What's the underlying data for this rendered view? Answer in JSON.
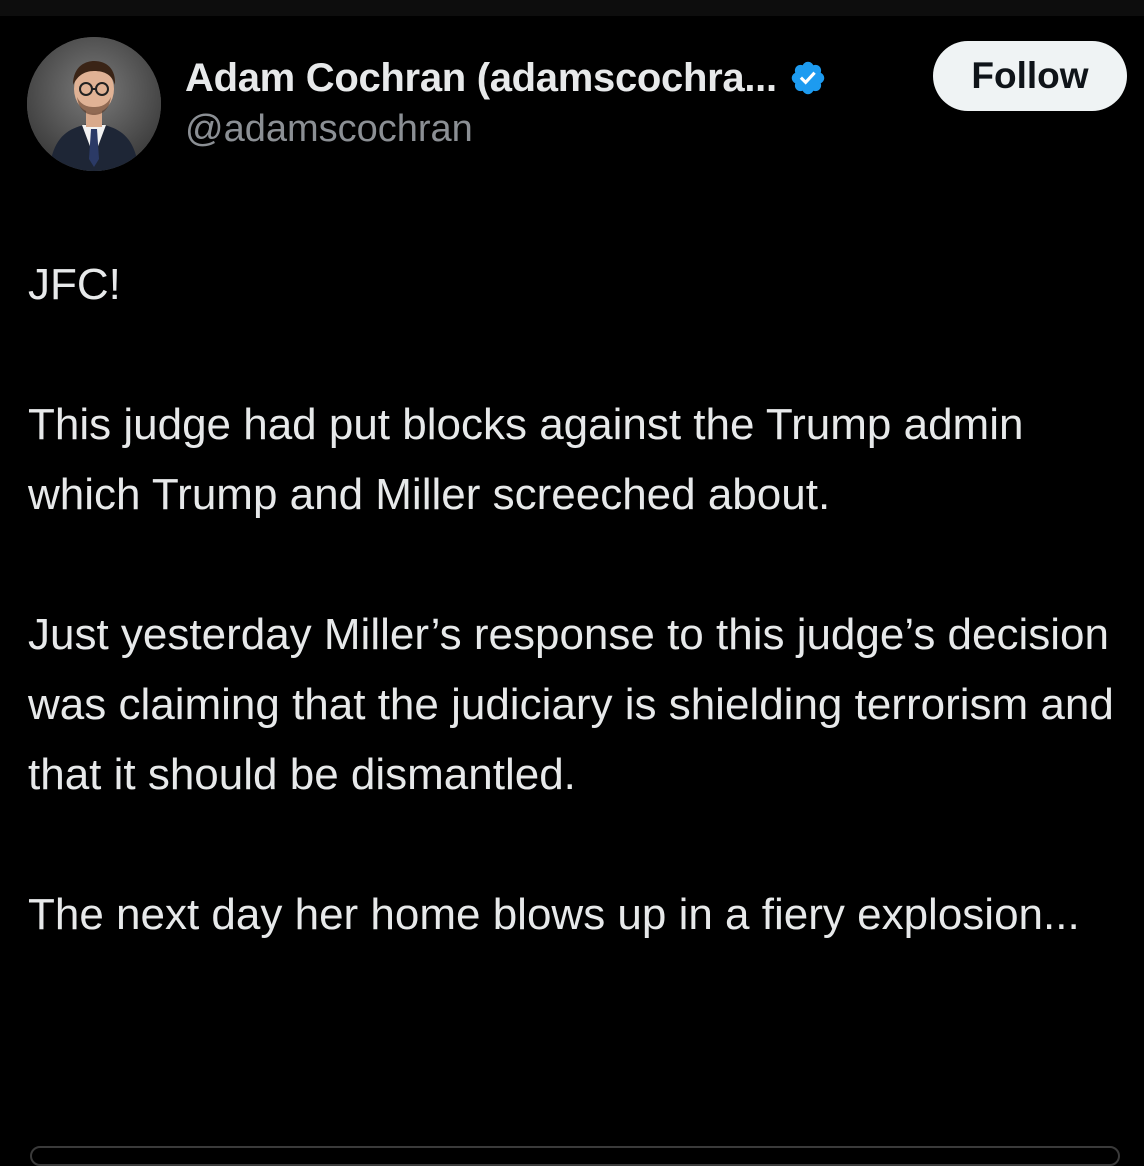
{
  "author": {
    "display_name": "Adam Cochran (adamscochra...",
    "handle": "@adamscochran",
    "verified": true,
    "verified_icon": "verified-badge-icon",
    "avatar_icon": "avatar-photo"
  },
  "actions": {
    "follow_label": "Follow"
  },
  "tweet": {
    "paragraphs": [
      "JFC!",
      "This judge had put blocks against the Trump admin which Trump and Miller screeched about.",
      "Just yesterday Miller’s response to this judge’s decision was claiming that the judiciary is shielding terrorism and that it should be dismantled.",
      "The next day her home blows up in a fiery explosion..."
    ]
  },
  "colors": {
    "background": "#000000",
    "text": "#e7e9ea",
    "secondary_text": "#8b8f94",
    "verified_blue": "#1d9bf0",
    "follow_button_bg": "#eff3f4",
    "follow_button_text": "#0f1419"
  }
}
